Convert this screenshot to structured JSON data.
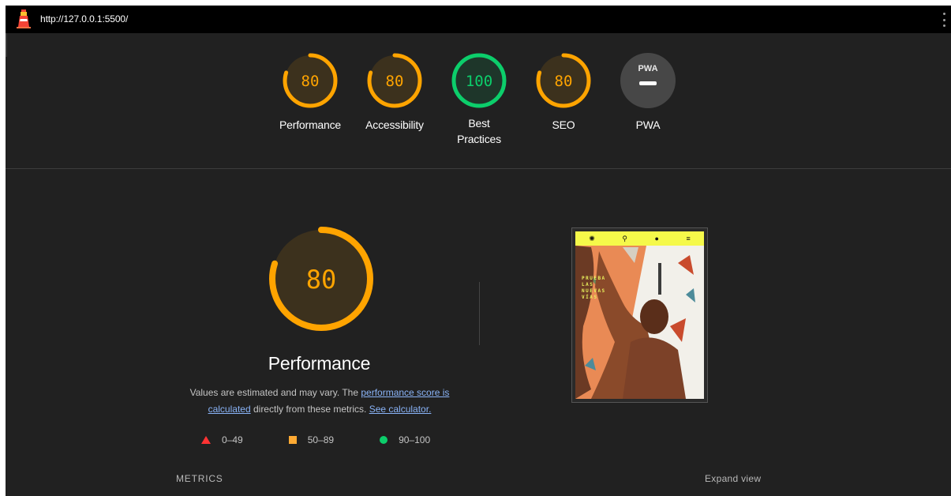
{
  "header": {
    "url": "http://127.0.0.1:5500/"
  },
  "colors": {
    "pass": "#0cce6b",
    "average": "#ffa400",
    "fail": "#ff3333",
    "background": "#212121",
    "link": "#8ab4f8"
  },
  "gauges": [
    {
      "score": "80",
      "label": "Performance",
      "fraction": 0.8,
      "status": "average"
    },
    {
      "score": "80",
      "label": "Accessibility",
      "fraction": 0.8,
      "status": "average"
    },
    {
      "score": "100",
      "label": "Best Practices",
      "fraction": 1.0,
      "status": "pass"
    },
    {
      "score": "80",
      "label": "SEO",
      "fraction": 0.8,
      "status": "average"
    },
    {
      "score": "",
      "label": "PWA",
      "badge_text": "PWA",
      "status": "na"
    }
  ],
  "performance": {
    "score": "80",
    "fraction": 0.8,
    "title": "Performance",
    "desc_prefix": "Values are estimated and may vary. The ",
    "desc_link1": "performance score is calculated",
    "desc_mid": " directly from these metrics. ",
    "desc_link2": "See calculator."
  },
  "legend": [
    {
      "range": "0–49",
      "shape": "triangle"
    },
    {
      "range": "50–89",
      "shape": "square"
    },
    {
      "range": "90–100",
      "shape": "circle"
    }
  ],
  "screenshot": {
    "overlay_text": [
      "PRUEBA",
      "LAS",
      "NUEVAS",
      "VÍAS"
    ]
  },
  "footer": {
    "metrics_label": "METRICS",
    "expand_label": "Expand view"
  }
}
